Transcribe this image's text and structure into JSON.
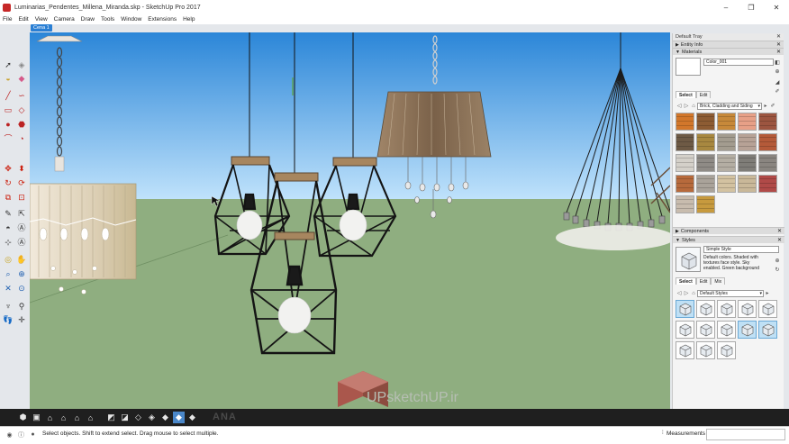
{
  "window": {
    "title": "Luminarias_Pendentes_Millena_Miranda.skp - SketchUp Pro 2017",
    "minimize": "–",
    "maximize": "❐",
    "close": "✕"
  },
  "menu": [
    "File",
    "Edit",
    "View",
    "Camera",
    "Draw",
    "Tools",
    "Window",
    "Extensions",
    "Help"
  ],
  "scene_tab": "Cena 1",
  "watermark": {
    "main": "UPsketchUP.ir",
    "bottom": "ANA"
  },
  "status": {
    "hint": "Select objects. Shift to extend select. Drag mouse to select multiple.",
    "measurements_label": "Measurements",
    "measurements_value": ""
  },
  "tray": {
    "title": "Default Tray",
    "sections": {
      "entity_info": "Entity Info",
      "materials": "Materials",
      "components": "Components",
      "styles": "Styles"
    },
    "materials": {
      "name": "Color_001",
      "tab_select": "Select",
      "tab_edit": "Edit",
      "library": "Brick, Cladding and Siding",
      "swatch_colors": [
        "#d2772b",
        "#8d5c33",
        "#c7893a",
        "#e7a087",
        "#9c5540",
        "#6e5a45",
        "#a88840",
        "#a39c8f",
        "#b7a296",
        "#b45a39",
        "#d4d0c9",
        "#8f8b86",
        "#b4aea3",
        "#7f7d78",
        "#8a8580",
        "#b76a3c",
        "#aaa39a",
        "#d3c2a1",
        "#c9b899",
        "#b04a48",
        "#c8bcae",
        "#c79a3e"
      ]
    },
    "styles": {
      "name": "Simple Style",
      "description": "Default colors.  Shaded with textures face style.  Sky enabled.  Green background",
      "tab_select": "Select",
      "tab_edit": "Edit",
      "tab_mix": "Mix",
      "library": "Default Styles"
    }
  },
  "colors": {
    "sky_top": "#2b86d8",
    "sky_bottom": "#bfe2fb",
    "ground": "#8fae80",
    "accent": "#2a7fd4"
  },
  "icons": {
    "left_toolbar": [
      "select-icon",
      "make-component-icon",
      "paint-bucket-icon",
      "eraser-icon",
      "line-icon",
      "freehand-icon",
      "rectangle-icon",
      "rotated-rectangle-icon",
      "circle-icon",
      "polygon-icon",
      "arc-icon",
      "pie-icon",
      "move-icon",
      "push-pull-icon",
      "rotate-icon",
      "follow-me-icon",
      "scale-icon",
      "offset-icon",
      "tape-measure-icon",
      "dimension-icon",
      "protractor-icon",
      "text-icon",
      "axes-icon",
      "3d-text-icon",
      "orbit-icon",
      "pan-icon",
      "zoom-icon",
      "zoom-window-icon",
      "zoom-extents-icon",
      "previous-view-icon",
      "position-camera-icon",
      "walk-icon"
    ],
    "bottom_toolbar": [
      "iso-view-icon",
      "top-view-icon",
      "front-view-icon",
      "right-view-icon",
      "back-view-icon",
      "left-view-icon",
      "xray-icon",
      "back-edges-icon",
      "wireframe-icon",
      "hidden-line-icon",
      "shaded-icon",
      "shaded-textures-icon",
      "monochrome-icon"
    ]
  }
}
